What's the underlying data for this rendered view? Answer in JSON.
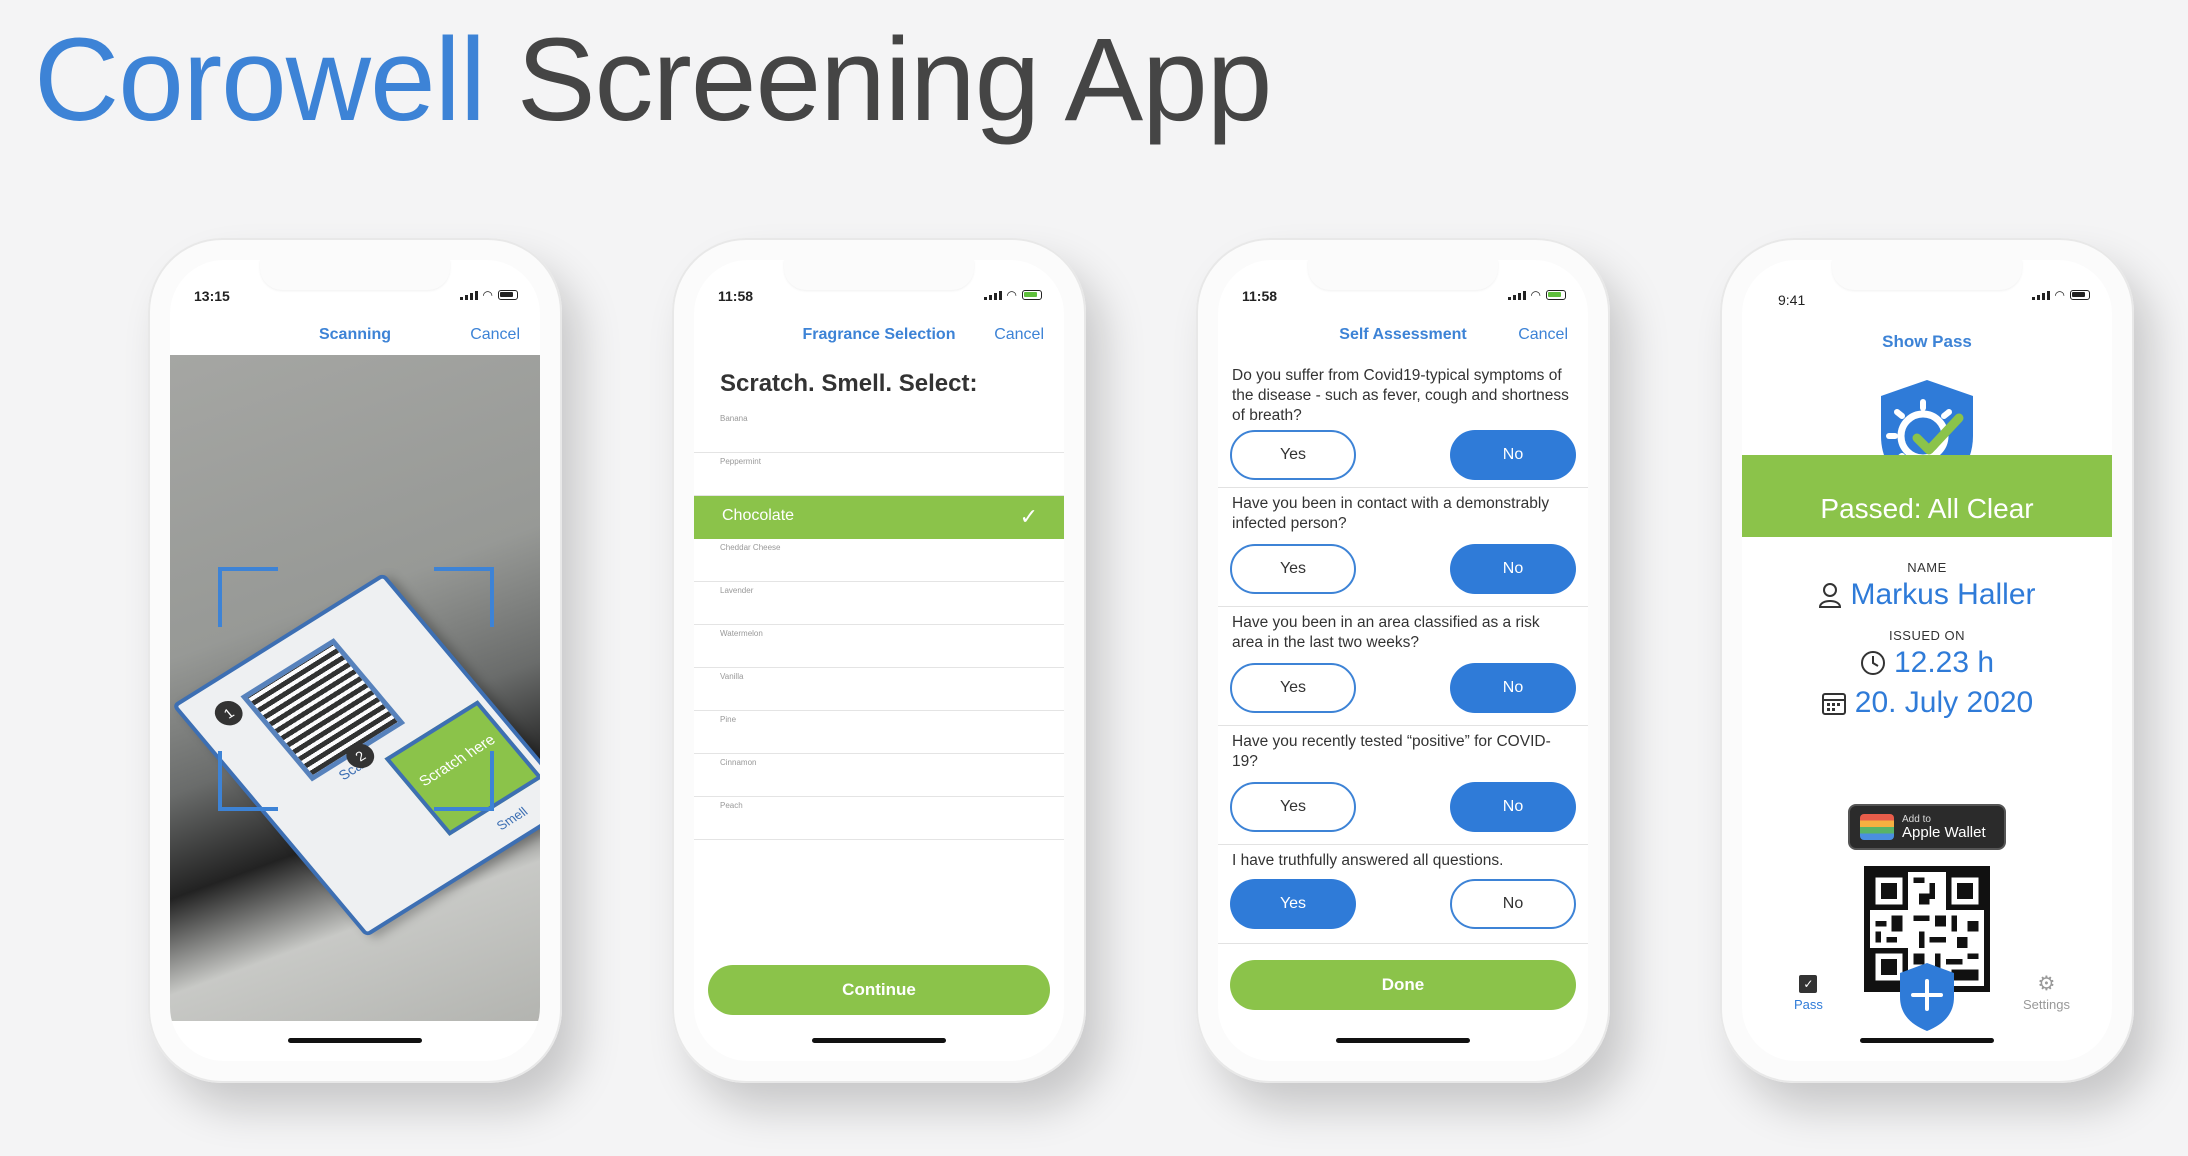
{
  "title": {
    "brand": "Corowell",
    "rest": "Screening App"
  },
  "colors": {
    "brand_blue": "#3d83d6",
    "green": "#8bc34a",
    "button_blue": "#2f7bd8"
  },
  "scanning": {
    "time": "13:15",
    "title": "Scanning",
    "cancel": "Cancel",
    "card": {
      "step1": "1",
      "scan": "Scan",
      "step2": "2",
      "scratch": "Scratch here",
      "smell": "Smell"
    }
  },
  "fragrance": {
    "time": "11:58",
    "title": "Fragrance Selection",
    "cancel": "Cancel",
    "heading": "Scratch. Smell. Select:",
    "items": [
      "Banana",
      "Peppermint",
      "Chocolate",
      "Cheddar Cheese",
      "Lavender",
      "Watermelon",
      "Vanilla",
      "Pine",
      "Cinnamon",
      "Peach"
    ],
    "selected": "Chocolate",
    "continue": "Continue"
  },
  "assessment": {
    "time": "11:58",
    "title": "Self Assessment",
    "cancel": "Cancel",
    "yes": "Yes",
    "no": "No",
    "questions": [
      {
        "text": "Do you suffer from Covid19-typical symptoms of the disease - such as fever, cough and shortness of breath?",
        "answer": "No"
      },
      {
        "text": "Have you been in contact with a demonstrably infected person?",
        "answer": "No"
      },
      {
        "text": "Have you been in an area classified as a risk area in the last two weeks?",
        "answer": "No"
      },
      {
        "text": "Have you recently tested “positive” for COVID-19?",
        "answer": "No"
      },
      {
        "text": "I have truthfully answered all questions.",
        "answer": "Yes"
      }
    ],
    "done": "Done"
  },
  "pass": {
    "time": "9:41",
    "title": "Show Pass",
    "status": "Passed: All Clear",
    "name_label": "NAME",
    "name": "Markus Haller",
    "issued_label": "ISSUED ON",
    "issued_time": "12.23 h",
    "issued_date": "20. July 2020",
    "wallet_small": "Add to",
    "wallet_big": "Apple Wallet",
    "tab_pass": "Pass",
    "tab_settings": "Settings"
  }
}
